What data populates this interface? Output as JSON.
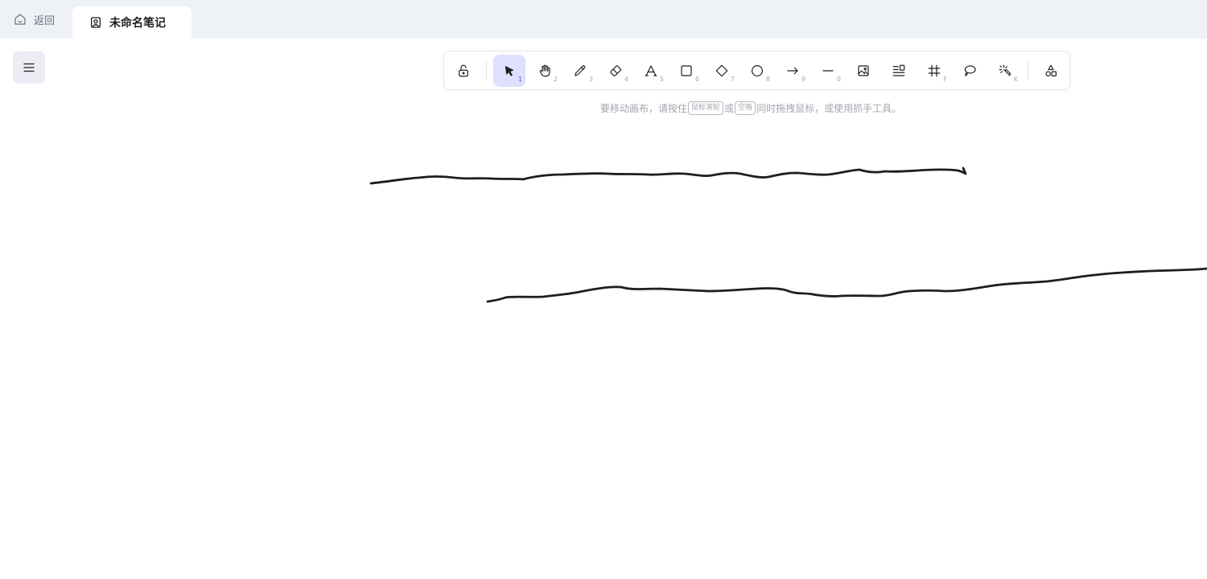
{
  "tabs": {
    "home_label": "返回",
    "active_label": "未命名笔记"
  },
  "toolbar": {
    "tools": [
      {
        "name": "lock-icon",
        "key": ""
      },
      {
        "name": "selection-icon",
        "key": "1",
        "active": true
      },
      {
        "name": "hand-icon",
        "key": "2"
      },
      {
        "name": "pencil-icon",
        "key": "3"
      },
      {
        "name": "eraser-icon",
        "key": "4"
      },
      {
        "name": "text-icon",
        "key": "5"
      },
      {
        "name": "rectangle-icon",
        "key": "6"
      },
      {
        "name": "diamond-icon",
        "key": "7"
      },
      {
        "name": "ellipse-icon",
        "key": "8"
      },
      {
        "name": "arrow-icon",
        "key": "9"
      },
      {
        "name": "line-icon",
        "key": "0"
      },
      {
        "name": "image-icon",
        "key": ""
      },
      {
        "name": "text-wrap-icon",
        "key": ""
      },
      {
        "name": "frame-icon",
        "key": "F"
      },
      {
        "name": "lasso-icon",
        "key": ""
      },
      {
        "name": "laser-icon",
        "key": "K"
      },
      {
        "name": "shapes-library-icon",
        "key": ""
      }
    ]
  },
  "hint": {
    "part1": "要移动画布，请按住",
    "key1": "鼠标滚轮",
    "part2": "或",
    "key2": "空格",
    "part3": "同时拖拽鼠标，或使用抓手工具。"
  },
  "colors": {
    "accent": "#5b57d1",
    "active_bg": "#e0dfff",
    "stroke": "#1e1e1e"
  }
}
